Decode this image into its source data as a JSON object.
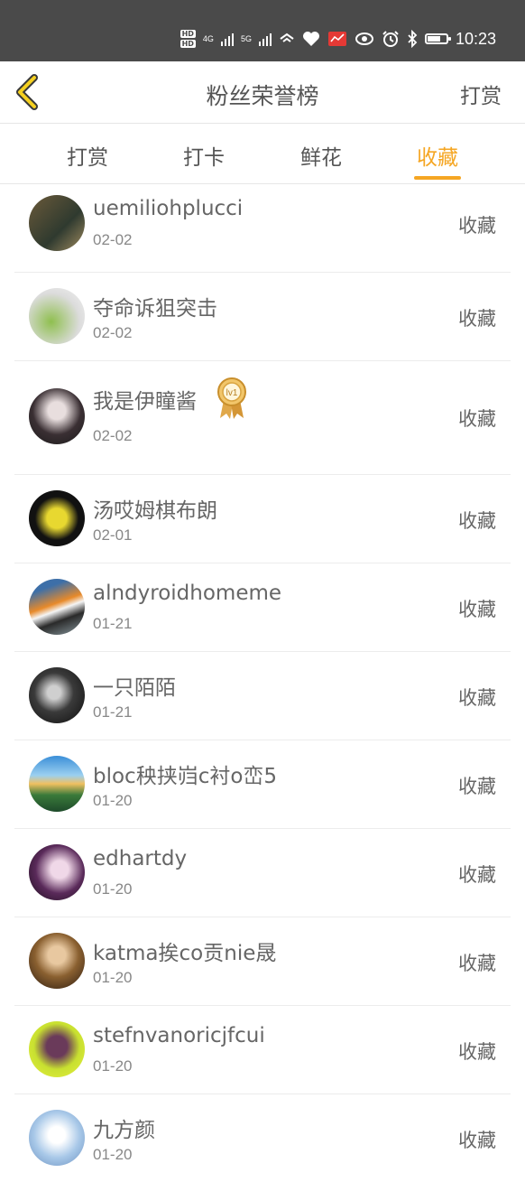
{
  "status_bar": {
    "time": "10:23",
    "net1": "4G",
    "net2": "5G"
  },
  "header": {
    "title": "粉丝荣誉榜",
    "action": "打赏"
  },
  "tabs": [
    {
      "label": "打赏",
      "active": false
    },
    {
      "label": "打卡",
      "active": false
    },
    {
      "label": "鲜花",
      "active": false
    },
    {
      "label": "收藏",
      "active": true
    }
  ],
  "accent_color": "#f5a623",
  "fans": [
    {
      "name": "uemiliohplucci",
      "date": "02-02",
      "action": "收藏"
    },
    {
      "name": "夺命诉狙突击",
      "date": "02-02",
      "action": "收藏"
    },
    {
      "name": "我是伊瞳酱",
      "date": "02-02",
      "action": "收藏",
      "badge": "lv1"
    },
    {
      "name": "汤哎姆棋布朗",
      "date": "02-01",
      "action": "收藏"
    },
    {
      "name": "alndyroidhomeme",
      "date": "01-21",
      "action": "收藏"
    },
    {
      "name": "一只陌陌",
      "date": "01-21",
      "action": "收藏"
    },
    {
      "name": "bloc秧挟岿c衬o峦5",
      "date": "01-20",
      "action": "收藏"
    },
    {
      "name": "edhartdy",
      "date": "01-20",
      "action": "收藏"
    },
    {
      "name": "katma挨co贡nie晟",
      "date": "01-20",
      "action": "收藏"
    },
    {
      "name": "stefnvanoricjfcui",
      "date": "01-20",
      "action": "收藏"
    },
    {
      "name": "九方颜",
      "date": "01-20",
      "action": "收藏"
    }
  ]
}
